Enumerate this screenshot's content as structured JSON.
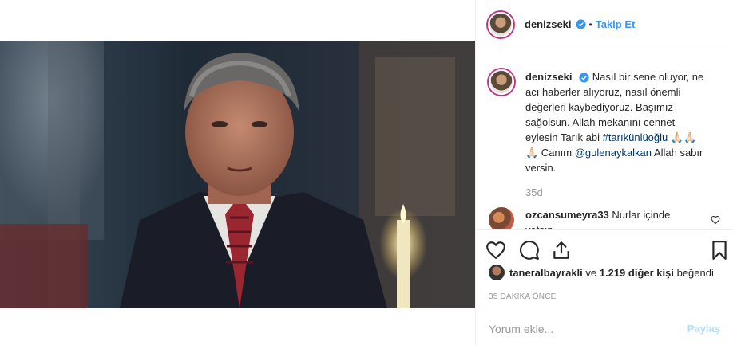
{
  "post": {
    "username": "denizseki",
    "follow_label": "Takip Et",
    "separator": "•",
    "caption": {
      "username": "denizseki",
      "text_before_tag": "Nasıl bir sene oluyor, ne acı haberler alıyoruz, nasıl önemli değerleri kaybediyoruz. Başımız sağolsun. Allah mekanını cennet eylesin Tarık abi ",
      "hashtag": "#tarıkünlüoğlu",
      "emoji": " 🙏🏻🙏🏻🙏🏻",
      "text_mid": " Canım ",
      "mention": "@gulenaykalkan",
      "text_after": " Allah sabır versin."
    },
    "caption_age": "35d",
    "comment": {
      "username": "ozcansumeyra33",
      "text": " Nurlar içinde yatsın"
    },
    "liked_by": {
      "user": "taneralbayrakli",
      "connector": " ve ",
      "count": "1.219 diğer kişi",
      "suffix": " beğendi"
    },
    "timestamp": "35 DAKİKA ÖNCE",
    "comment_placeholder": "Yorum ekle...",
    "share_label": "Paylaş"
  },
  "icons": [
    "verified-badge-icon",
    "heart-icon",
    "comment-icon",
    "share-icon",
    "bookmark-icon"
  ],
  "colors": {
    "accent": "#3897f0",
    "link": "#003569",
    "muted": "#999999",
    "share_disabled": "#b2dffc",
    "story_ring": "#c13584"
  }
}
